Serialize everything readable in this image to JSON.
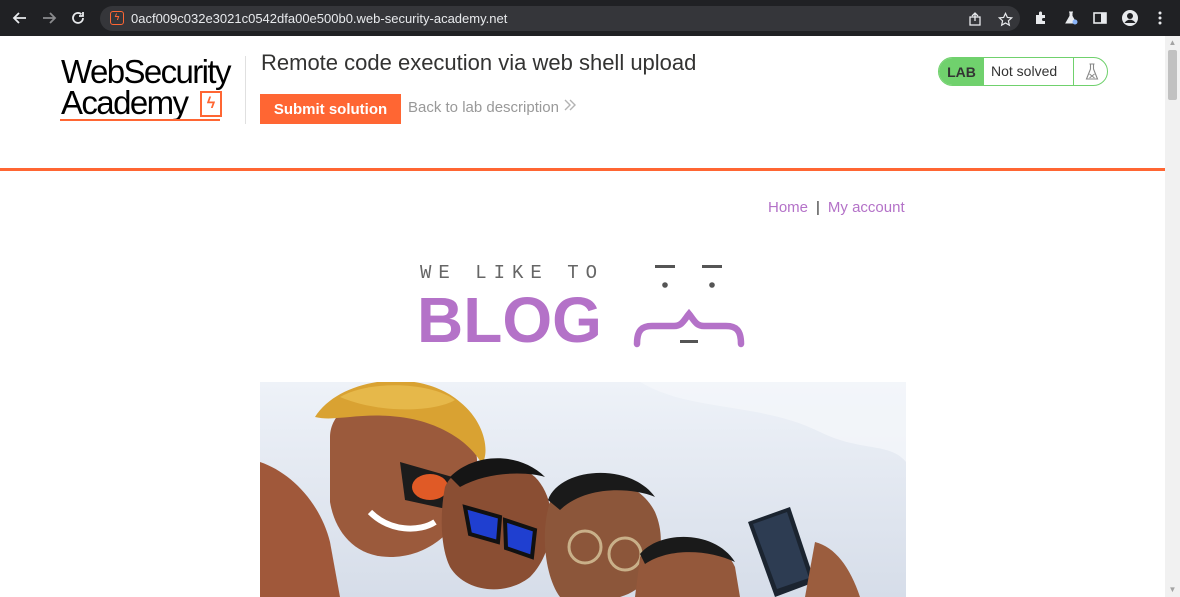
{
  "browser": {
    "url": "0acf009c032e3021c0542dfa00e500b0.web-security-academy.net"
  },
  "academy": {
    "logo_line1": "WebSecurity",
    "logo_line2": "Academy",
    "lab_title": "Remote code execution via web shell upload",
    "submit_label": "Submit solution",
    "back_label": "Back to lab description",
    "status_badge": "LAB",
    "status_text": "Not solved",
    "accent_color": "#ff6633",
    "status_color": "#70d16d"
  },
  "blog": {
    "nav": {
      "home": "Home",
      "separator": "|",
      "account": "My account"
    },
    "logo_top": "WE LIKE TO",
    "logo_main": "BLOG",
    "brand_color": "#b472c8"
  },
  "hero": {
    "image": "group-selfie-photo"
  }
}
